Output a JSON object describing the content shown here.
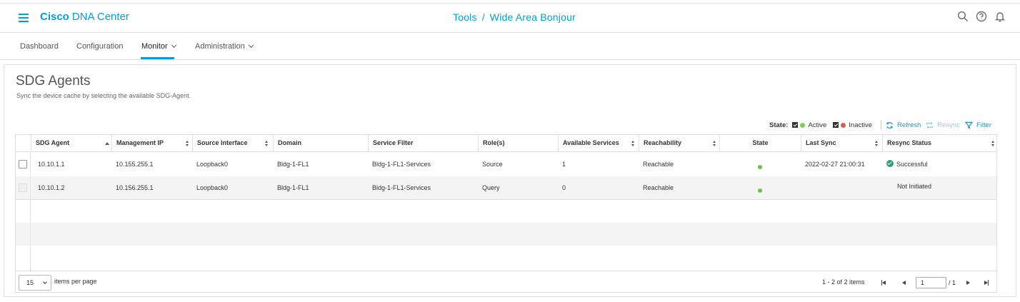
{
  "app": {
    "brand_bold": "Cisco",
    "brand_rest": "DNA Center"
  },
  "breadcrumb": {
    "parent": "Tools",
    "separator": "/",
    "current": "Wide Area Bonjour"
  },
  "top_icons": [
    "search-icon",
    "help-icon",
    "bell-icon"
  ],
  "nav": {
    "dashboard": "Dashboard",
    "configuration": "Configuration",
    "monitor": "Monitor",
    "administration": "Administration"
  },
  "page": {
    "title": "SDG Agents",
    "subtitle": "Sync the device cache by selecting the available SDG-Agent."
  },
  "toolbar": {
    "state_label": "State:",
    "active_label": "Active",
    "inactive_label": "Inactive",
    "active_color": "#7ccf5a",
    "inactive_color": "#e05b4f",
    "refresh": "Refresh",
    "resync": "Resync",
    "filter": "Filter"
  },
  "table": {
    "columns": [
      "SDG Agent",
      "Management IP",
      "Source Interface",
      "Domain",
      "Service Filter",
      "Role(s)",
      "Available Services",
      "Reachability",
      "State",
      "Last Sync",
      "Resync Status"
    ],
    "rows": [
      {
        "agent": "10.10.1.1",
        "ip": "10.155.255.1",
        "iface": "Loopback0",
        "domain": "Bldg-1-FL1",
        "filter": "Bldg-1-FL1-Services",
        "role": "Source",
        "services": "1",
        "reach": "Reachable",
        "state": "active",
        "last_sync": "2022-02-27 21:00:31",
        "resync": "Successful"
      },
      {
        "agent": "10.10.1.2",
        "ip": "10.156.255.1",
        "iface": "Loopback0",
        "domain": "Bldg-1-FL1",
        "filter": "Bldg-1-FL1-Services",
        "role": "Query",
        "services": "0",
        "reach": "Reachable",
        "state": "active",
        "last_sync": "",
        "resync": "Not Initiated"
      }
    ]
  },
  "pagination": {
    "per_page": "15",
    "per_page_label": "items per page",
    "count": "1 - 2 of 2 items",
    "page": "1",
    "total_pages": "/ 1"
  }
}
